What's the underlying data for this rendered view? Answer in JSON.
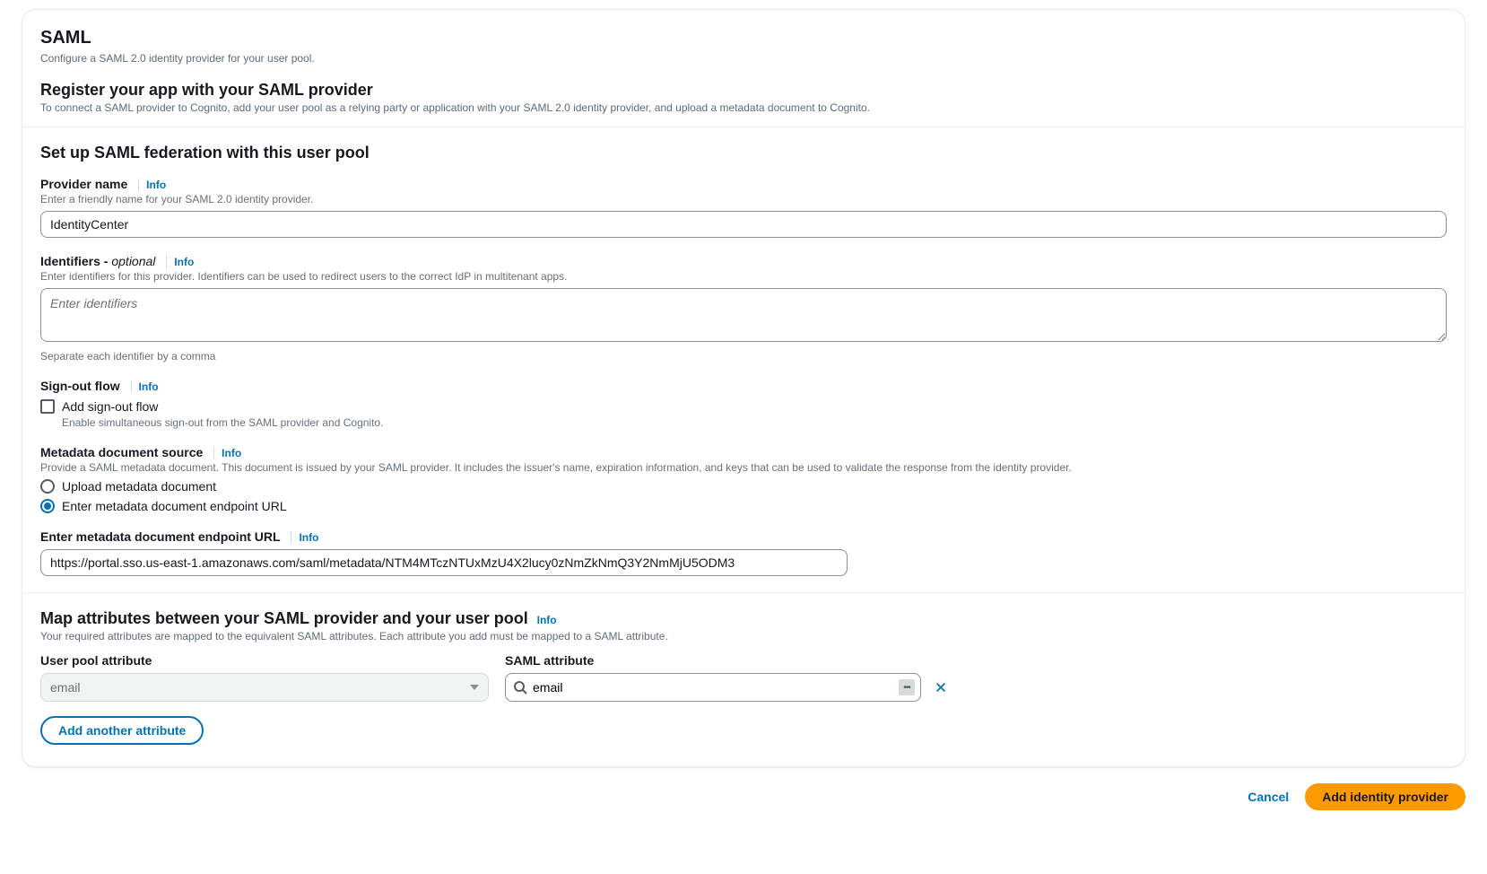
{
  "header": {
    "title": "SAML",
    "subtitle": "Configure a SAML 2.0 identity provider for your user pool."
  },
  "register": {
    "title": "Register your app with your SAML provider",
    "desc": "To connect a SAML provider to Cognito, add your user pool as a relying party or application with your SAML 2.0 identity provider, and upload a metadata document to Cognito."
  },
  "setup": {
    "title": "Set up SAML federation with this user pool"
  },
  "provider_name": {
    "label": "Provider name",
    "info": "Info",
    "hint": "Enter a friendly name for your SAML 2.0 identity provider.",
    "value": "IdentityCenter"
  },
  "identifiers": {
    "label": "Identifiers - ",
    "optional": "optional",
    "info": "Info",
    "hint": "Enter identifiers for this provider. Identifiers can be used to redirect users to the correct IdP in multitenant apps.",
    "placeholder": "Enter identifiers",
    "below": "Separate each identifier by a comma"
  },
  "signout": {
    "label": "Sign-out flow",
    "info": "Info",
    "checkbox_label": "Add sign-out flow",
    "checkbox_sub": "Enable simultaneous sign-out from the SAML provider and Cognito."
  },
  "metadata": {
    "label": "Metadata document source",
    "info": "Info",
    "hint": "Provide a SAML metadata document. This document is issued by your SAML provider. It includes the issuer's name, expiration information, and keys that can be used to validate the response from the identity provider.",
    "option_upload": "Upload metadata document",
    "option_url": "Enter metadata document endpoint URL"
  },
  "endpoint": {
    "label": "Enter metadata document endpoint URL",
    "info": "Info",
    "value": "https://portal.sso.us-east-1.amazonaws.com/saml/metadata/NTM4MTczNTUxMzU4X2lucy0zNmZkNmQ3Y2NmMjU5ODM3"
  },
  "map": {
    "title": "Map attributes between your SAML provider and your user pool",
    "info": "Info",
    "desc": "Your required attributes are mapped to the equivalent SAML attributes. Each attribute you add must be mapped to a SAML attribute.",
    "col_userpool": "User pool attribute",
    "col_saml": "SAML attribute",
    "userpool_value": "email",
    "saml_value": "email",
    "add_button": "Add another attribute"
  },
  "footer": {
    "cancel": "Cancel",
    "submit": "Add identity provider"
  }
}
